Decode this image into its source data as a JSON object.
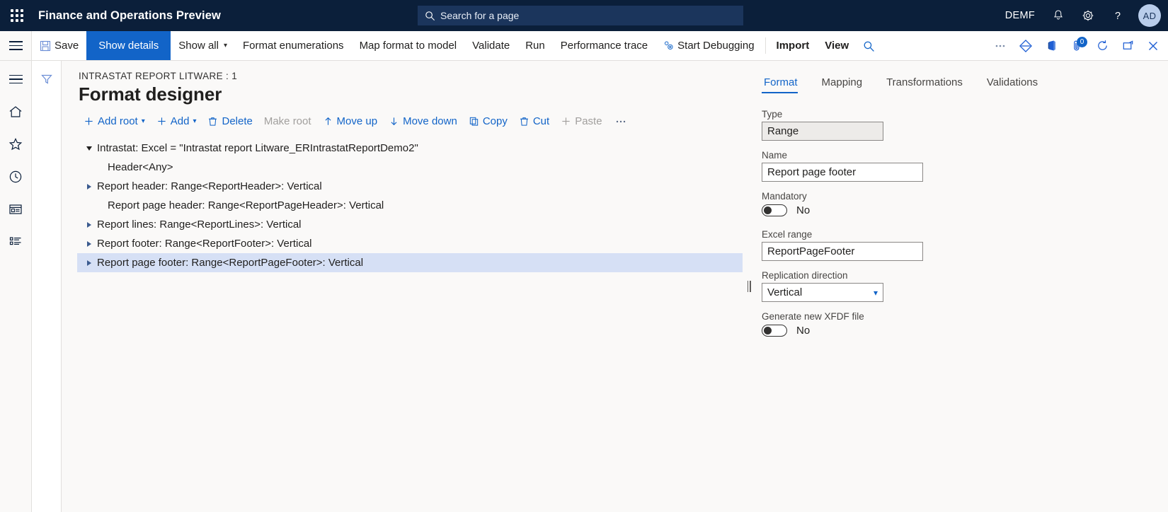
{
  "topnav": {
    "waffle_label": "App launcher",
    "app_title": "Finance and Operations Preview",
    "search_placeholder": "Search for a page",
    "company": "DEMF",
    "avatar_initials": "AD",
    "icons": [
      "waffle-icon",
      "search-icon",
      "bell-icon",
      "gear-icon",
      "help-icon",
      "avatar"
    ]
  },
  "commandbar": {
    "save": "Save",
    "show_details": "Show details",
    "show_all": "Show all",
    "format_enumerations": "Format enumerations",
    "map_format_to_model": "Map format to model",
    "validate": "Validate",
    "run": "Run",
    "performance_trace": "Performance trace",
    "start_debugging": "Start Debugging",
    "import": "Import",
    "view": "View",
    "attachment_badge": "0"
  },
  "page": {
    "breadcrumb": "INTRASTAT REPORT LITWARE : 1",
    "title": "Format designer"
  },
  "actions": {
    "add_root": "Add root",
    "add": "Add",
    "delete": "Delete",
    "make_root": "Make root",
    "move_up": "Move up",
    "move_down": "Move down",
    "copy": "Copy",
    "cut": "Cut",
    "paste": "Paste",
    "more": "···"
  },
  "tree": {
    "nodes": [
      {
        "label": "Intrastat: Excel = \"Intrastat report Litware_ERIntrastatReportDemo2\"",
        "level": 1,
        "expander": "down",
        "selected": false
      },
      {
        "label": "Header<Any>",
        "level": 2,
        "expander": "none",
        "selected": false
      },
      {
        "label": "Report header: Range<ReportHeader>: Vertical",
        "level": 2,
        "expander": "right",
        "selected": false
      },
      {
        "label": "Report page header: Range<ReportPageHeader>: Vertical",
        "level": 2,
        "expander": "none",
        "selected": false
      },
      {
        "label": "Report lines: Range<ReportLines>: Vertical",
        "level": 2,
        "expander": "right",
        "selected": false
      },
      {
        "label": "Report footer: Range<ReportFooter>: Vertical",
        "level": 2,
        "expander": "right",
        "selected": false
      },
      {
        "label": "Report page footer: Range<ReportPageFooter>: Vertical",
        "level": 2,
        "expander": "right",
        "selected": true
      }
    ]
  },
  "properties": {
    "tabs": [
      {
        "label": "Format",
        "active": true
      },
      {
        "label": "Mapping",
        "active": false
      },
      {
        "label": "Transformations",
        "active": false
      },
      {
        "label": "Validations",
        "active": false
      }
    ],
    "type_label": "Type",
    "type_value": "Range",
    "name_label": "Name",
    "name_value": "Report page footer",
    "mandatory_label": "Mandatory",
    "mandatory_value": "No",
    "excel_range_label": "Excel range",
    "excel_range_value": "ReportPageFooter",
    "replication_label": "Replication direction",
    "replication_value": "Vertical",
    "xfdf_label": "Generate new XFDF file",
    "xfdf_value": "No"
  },
  "colors": {
    "navy": "#0b1f3a",
    "accent": "#1264c8",
    "selection": "#d6e0f5",
    "canvas": "#faf9f8"
  }
}
